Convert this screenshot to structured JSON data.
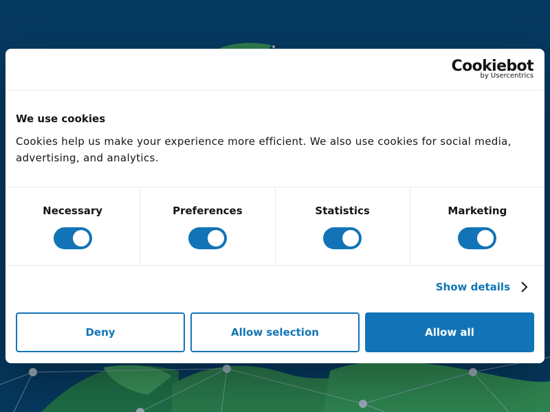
{
  "colors": {
    "accent": "#1274b6",
    "background": "#06395f",
    "text": "#141414"
  },
  "brand": {
    "name": "Cookiebot",
    "tagline": "by Usercentrics"
  },
  "banner": {
    "title": "We use cookies",
    "text": "Cookies help us make your experience more efficient. We also use cookies for social media, advertising, and analytics."
  },
  "categories": [
    {
      "label": "Necessary",
      "enabled": true
    },
    {
      "label": "Preferences",
      "enabled": true
    },
    {
      "label": "Statistics",
      "enabled": true
    },
    {
      "label": "Marketing",
      "enabled": true
    }
  ],
  "details_link": {
    "label": "Show details",
    "icon": "chevron-right-icon"
  },
  "buttons": {
    "deny": "Deny",
    "allow_selection": "Allow selection",
    "allow_all": "Allow all"
  }
}
